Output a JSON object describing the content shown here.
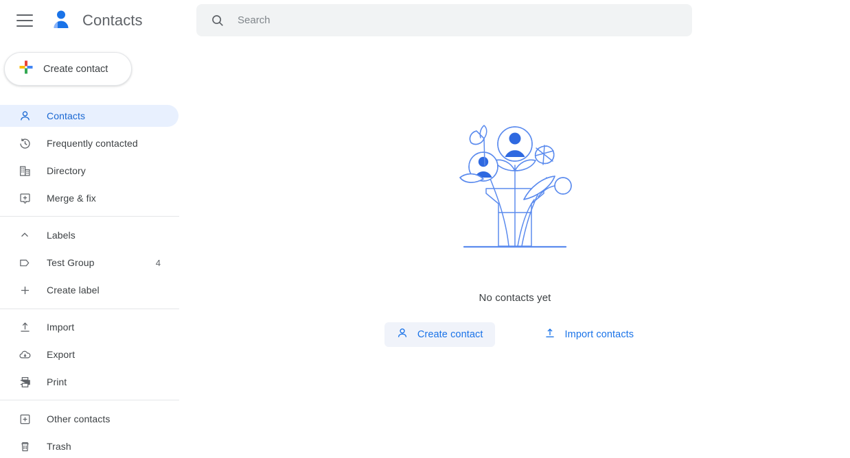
{
  "app": {
    "title": "Contacts",
    "logo_icon": "contacts-person-logo",
    "menu_icon": "hamburger-menu-icon"
  },
  "create_contact_button": {
    "label": "Create contact",
    "icon": "google-plus-icon"
  },
  "search": {
    "placeholder": "Search",
    "value": "",
    "icon": "search-icon"
  },
  "sidebar": {
    "primary_items": [
      {
        "label": "Contacts",
        "icon": "person-icon",
        "active": true,
        "count": ""
      },
      {
        "label": "Frequently contacted",
        "icon": "history-clock-icon",
        "active": false,
        "count": ""
      },
      {
        "label": "Directory",
        "icon": "building-icon",
        "active": false,
        "count": ""
      },
      {
        "label": "Merge & fix",
        "icon": "merge-fix-icon",
        "active": false,
        "count": ""
      }
    ],
    "labels_section": {
      "header_label": "Labels",
      "header_icon": "chevron-up-icon",
      "items": [
        {
          "label": "Test Group",
          "icon": "label-tag-icon",
          "count": "4"
        },
        {
          "label": "Create label",
          "icon": "plus-icon",
          "count": ""
        }
      ]
    },
    "tools_items": [
      {
        "label": "Import",
        "icon": "upload-icon",
        "count": ""
      },
      {
        "label": "Export",
        "icon": "cloud-download-icon",
        "count": ""
      },
      {
        "label": "Print",
        "icon": "printer-icon",
        "count": ""
      }
    ],
    "footer_items": [
      {
        "label": "Other contacts",
        "icon": "other-contacts-icon",
        "count": ""
      },
      {
        "label": "Trash",
        "icon": "trash-icon",
        "count": ""
      }
    ]
  },
  "empty_state": {
    "illustration": "flowers-in-vase-illustration",
    "title": "No contacts yet",
    "actions": [
      {
        "label": "Create contact",
        "icon": "person-add-icon",
        "filled": true
      },
      {
        "label": "Import contacts",
        "icon": "upload-icon",
        "filled": false
      }
    ]
  },
  "colors": {
    "accent_blue": "#1a73e8",
    "active_pill": "#e8f0fe",
    "active_text": "#1967d2",
    "text_primary": "#3c4043",
    "text_secondary": "#5f6368",
    "search_bg": "#f1f3f4",
    "illustration_blue": "#4a7de8",
    "google_red": "#ea4335",
    "google_yellow": "#fbbc04",
    "google_green": "#34a853",
    "google_blue": "#4285f4"
  }
}
